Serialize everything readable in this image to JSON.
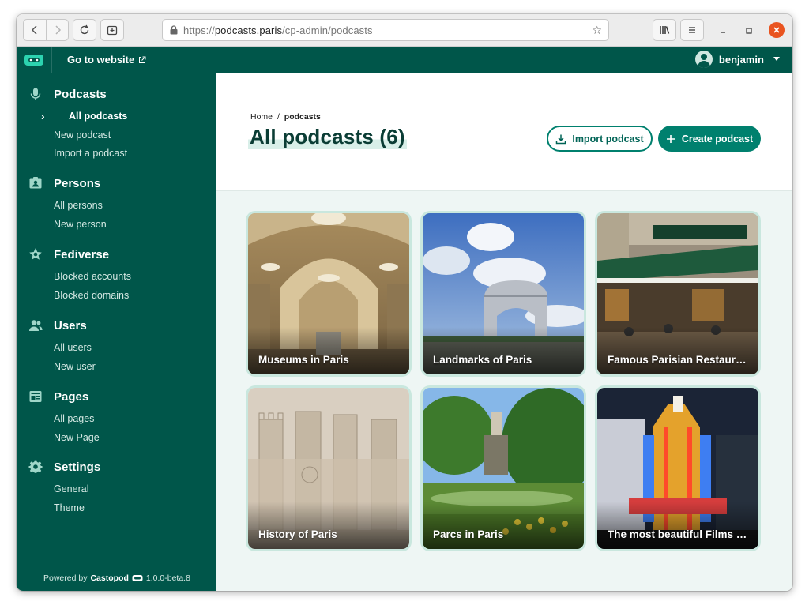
{
  "browser": {
    "url_prefix": "https://",
    "url_host": "podcasts.paris",
    "url_path": "/cp-admin/podcasts"
  },
  "topbar": {
    "goto_label": "Go to website",
    "username": "benjamin"
  },
  "sidebar": {
    "sections": [
      {
        "title": "Podcasts",
        "icon": "microphone-icon",
        "items": [
          "All podcasts",
          "New podcast",
          "Import a podcast"
        ],
        "active": 0
      },
      {
        "title": "Persons",
        "icon": "contact-card-icon",
        "items": [
          "All persons",
          "New person"
        ]
      },
      {
        "title": "Fediverse",
        "icon": "star-badge-icon",
        "items": [
          "Blocked accounts",
          "Blocked domains"
        ]
      },
      {
        "title": "Users",
        "icon": "users-icon",
        "items": [
          "All users",
          "New user"
        ]
      },
      {
        "title": "Pages",
        "icon": "pages-icon",
        "items": [
          "All pages",
          "New Page"
        ]
      },
      {
        "title": "Settings",
        "icon": "gear-icon",
        "items": [
          "General",
          "Theme"
        ]
      }
    ],
    "powered_prefix": "Powered by",
    "powered_brand": "Castopod",
    "version": "1.0.0-beta.8"
  },
  "main": {
    "breadcrumb_home": "Home",
    "breadcrumb_sep": "/",
    "breadcrumb_current": "podcasts",
    "title": "All podcasts (6)",
    "import_label": "Import podcast",
    "create_label": "Create podcast"
  },
  "podcasts": [
    {
      "title": "Museums in Paris"
    },
    {
      "title": "Landmarks of Paris"
    },
    {
      "title": "Famous Parisian Restaurants"
    },
    {
      "title": "History of Paris"
    },
    {
      "title": "Parcs in Paris"
    },
    {
      "title": "The most beautiful Films shot in Paris"
    }
  ],
  "colors": {
    "brand": "#00564a",
    "accent": "#00806e"
  }
}
